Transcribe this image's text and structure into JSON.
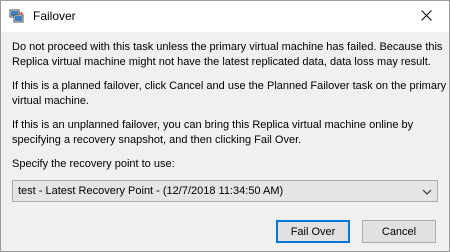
{
  "window": {
    "title": "Failover",
    "close_glyph": "✕"
  },
  "message": {
    "para1_line1": "Do not proceed with this task unless the primary virtual machine has failed. Because this",
    "para1_line2": "Replica virtual machine might not have the latest replicated data, data loss may result.",
    "para2_line1": "If this is a planned failover, click Cancel and use the Planned Failover task on the primary",
    "para2_line2": "virtual machine.",
    "para3_line1": "If this is an unplanned failover, you can bring this Replica virtual machine online by",
    "para3_line2": "specifying a recovery snapshot, and then clicking Fail Over."
  },
  "recovery": {
    "label": "Specify the recovery point to use:",
    "selected_value": "test - Latest Recovery Point - (12/7/2018 11:34:50 AM)"
  },
  "buttons": {
    "fail_over": "Fail Over",
    "cancel": "Cancel"
  },
  "icons": {
    "app": "hyper-v-replica-icon",
    "close": "close-icon",
    "dropdown": "chevron-down-icon"
  },
  "colors": {
    "focus_border": "#0078d7",
    "dialog_background": "#f0f0f0",
    "titlebar_background": "#ffffff"
  }
}
